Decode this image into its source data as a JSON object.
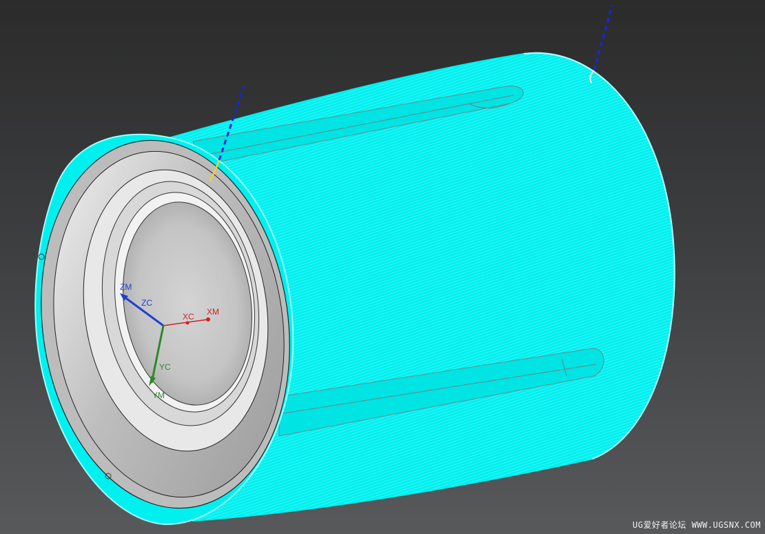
{
  "viewport": {
    "background_top": "#2b2b2b",
    "background_bottom": "#58595b"
  },
  "model": {
    "toolpath_color": "#00f0f0",
    "part_face_color": "#c8c8c8",
    "engage_color": "#f2d32a",
    "retract_color": "#1428d8"
  },
  "wcs": {
    "zm_label": "ZM",
    "zc_label": "ZC",
    "xc_label": "XC",
    "xm_label": "XM",
    "yc_label": "YC",
    "ym_label": "YM",
    "x_color": "#d42020",
    "y_color": "#2a8a2a",
    "z_color": "#2040d0"
  },
  "watermark": {
    "text": "UG爱好者论坛 WWW.UGSNX.COM"
  }
}
